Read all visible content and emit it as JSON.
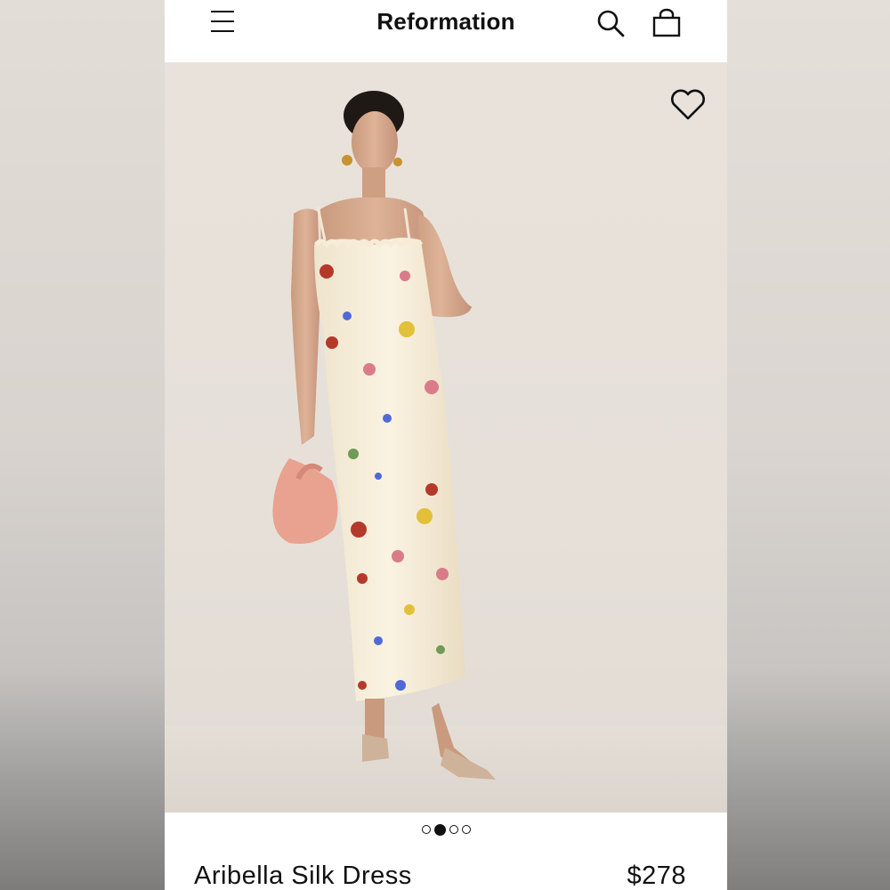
{
  "header": {
    "brand": "Reformation",
    "menu_icon": "hamburger-menu-icon",
    "search_icon": "search-icon",
    "bag_icon": "shopping-bag-icon"
  },
  "gallery": {
    "favorite_icon": "heart-outline-icon",
    "image_count": 4,
    "active_index": 1
  },
  "product": {
    "name": "Aribella Silk Dress",
    "price": "$278"
  },
  "colors": {
    "background": "#ffffff",
    "text": "#111111",
    "photo_backdrop": "#e6e0d9",
    "handbag": "#e8a28f"
  }
}
